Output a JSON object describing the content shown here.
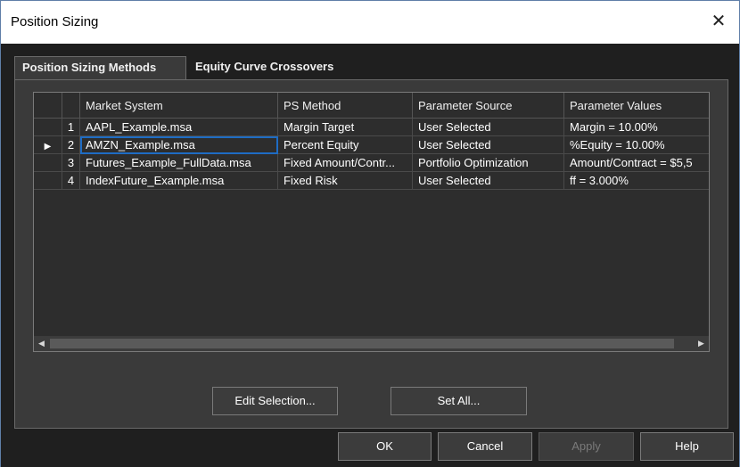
{
  "window": {
    "title": "Position Sizing",
    "close_glyph": "✕"
  },
  "tabs": [
    {
      "label": "Position Sizing Methods",
      "active": true
    },
    {
      "label": "Equity Curve Crossovers",
      "active": false
    }
  ],
  "grid": {
    "columns": [
      "Market System",
      "PS Method",
      "Parameter Source",
      "Parameter Values"
    ],
    "rows": [
      {
        "num": "1",
        "system": "AAPL_Example.msa",
        "method": "Margin Target",
        "source": "User Selected",
        "values": "Margin = 10.00%"
      },
      {
        "num": "2",
        "system": "AMZN_Example.msa",
        "method": "Percent Equity",
        "source": "User Selected",
        "values": "%Equity = 10.00%"
      },
      {
        "num": "3",
        "system": "Futures_Example_FullData.msa",
        "method": "Fixed Amount/Contr...",
        "source": "Portfolio Optimization",
        "values": "Amount/Contract = $5,5"
      },
      {
        "num": "4",
        "system": "IndexFuture_Example.msa",
        "method": "Fixed Risk",
        "source": "User Selected",
        "values": "ff = 3.000%"
      }
    ],
    "current_row_indicator": "▶",
    "scroll_left_glyph": "◀",
    "scroll_right_glyph": "▶"
  },
  "actions": {
    "edit_selection": "Edit Selection...",
    "set_all": "Set All..."
  },
  "footer": {
    "ok": "OK",
    "cancel": "Cancel",
    "apply": "Apply",
    "help": "Help"
  },
  "colors": {
    "client_bg": "#1f1f1f",
    "panel_bg": "#3a3a3a",
    "grid_bg": "#2d2d2d",
    "selection_outline": "#1e6cc4"
  },
  "icons": [
    "close-icon",
    "row-indicator-arrow-icon",
    "scroll-left-arrow-icon",
    "scroll-right-arrow-icon"
  ]
}
